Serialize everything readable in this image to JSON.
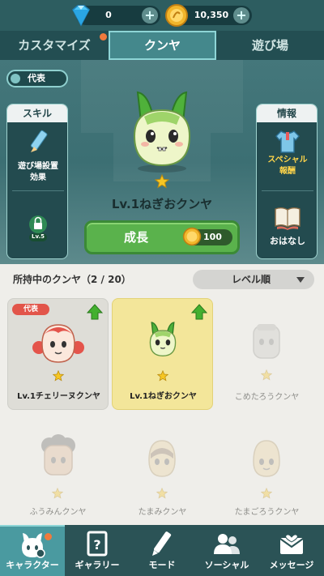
{
  "currency": {
    "gems": "0",
    "coins": "10,350",
    "gem_icon": "diamond-icon",
    "coin_icon": "coin-icon"
  },
  "tabs": {
    "customize": "カスタマイズ",
    "kunya": "クンヤ",
    "playground": "遊び場"
  },
  "hero": {
    "representative_toggle": "代表",
    "skill_panel": {
      "title": "スキル",
      "item_line1": "遊び場設置",
      "item_line2": "効果",
      "lock_level": "Lv.5"
    },
    "info_panel": {
      "title": "情報",
      "special_line1": "スペシャル",
      "special_line2": "報酬",
      "story": "おはなし"
    },
    "character_name": "Lv.1ねぎおクンヤ",
    "grow_button": "成長",
    "grow_cost": "100"
  },
  "collection": {
    "title": "所持中のクンヤ（2 / 20）",
    "sort": "レベル順",
    "cards": [
      {
        "name": "Lv.1チェリーヌクンヤ",
        "badge": "代表",
        "state": "owned"
      },
      {
        "name": "Lv.1ねぎおクンヤ",
        "badge": "",
        "state": "selected"
      },
      {
        "name": "こめたろうクンヤ",
        "badge": "",
        "state": "locked"
      },
      {
        "name": "ふうみんクンヤ",
        "badge": "",
        "state": "locked"
      },
      {
        "name": "たまみクンヤ",
        "badge": "",
        "state": "locked"
      },
      {
        "name": "たまごろうクンヤ",
        "badge": "",
        "state": "locked"
      }
    ]
  },
  "bottom_nav": [
    {
      "label": "キャラクター",
      "icon": "character-icon",
      "active": true
    },
    {
      "label": "ギャラリー",
      "icon": "gallery-icon",
      "active": false
    },
    {
      "label": "モード",
      "icon": "pen-icon",
      "active": false
    },
    {
      "label": "ソーシャル",
      "icon": "social-icon",
      "active": false
    },
    {
      "label": "メッセージ",
      "icon": "mail-icon",
      "active": false
    }
  ],
  "colors": {
    "accent": "#44888c",
    "grow_button": "#5ab24c",
    "selected_card": "#f3e69a",
    "badge": "#e2554a"
  }
}
